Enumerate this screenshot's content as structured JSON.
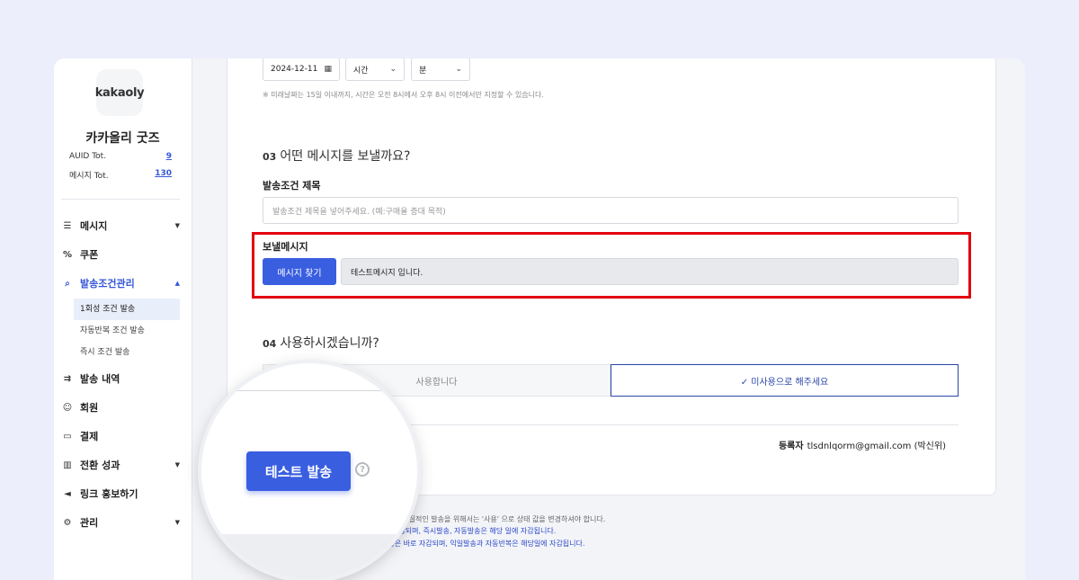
{
  "sidebar": {
    "logo_text": "kakaoly",
    "shop_name": "카카올리 굿즈",
    "stats": [
      {
        "label": "AUID Tot.",
        "value": "9"
      },
      {
        "label": "메시지 Tot.",
        "value": "130"
      }
    ],
    "nav": [
      {
        "label": "메시지",
        "icon": "message-icon",
        "glyph": "☰",
        "chevron": "▼"
      },
      {
        "label": "쿠폰",
        "icon": "percent-icon",
        "glyph": "%",
        "chevron": ""
      },
      {
        "label": "발송조건관리",
        "icon": "search-list-icon",
        "glyph": "⌕",
        "chevron": "▲"
      },
      {
        "label": "발송 내역",
        "icon": "send-history-icon",
        "glyph": "⇉",
        "chevron": ""
      },
      {
        "label": "회원",
        "icon": "members-icon",
        "glyph": "☺",
        "chevron": ""
      },
      {
        "label": "결제",
        "icon": "card-icon",
        "glyph": "▭",
        "chevron": ""
      },
      {
        "label": "전환 성과",
        "icon": "bar-chart-icon",
        "glyph": "▥",
        "chevron": "▼"
      },
      {
        "label": "링크 홍보하기",
        "icon": "megaphone-icon",
        "glyph": "◄",
        "chevron": ""
      },
      {
        "label": "관리",
        "icon": "gear-icon",
        "glyph": "⚙",
        "chevron": "▼"
      }
    ],
    "sub_items": [
      "1회성 조건 발송",
      "자동반복 조건 발송",
      "즉시 조건 발송"
    ]
  },
  "schedule": {
    "date": "2024-12-11",
    "hour_placeholder": "시간",
    "minute_placeholder": "분",
    "note": "※ 미래날짜는 15일 이내까지, 시간은 오전 8시에서 오후 8시 이전에서만 지정할 수 있습니다."
  },
  "section3": {
    "number": "03",
    "title": "어떤 메시지를 보낼까요?",
    "condition_label": "발송조건 제목",
    "condition_placeholder": "발송조건 제목을 넣어주세요. (예:구매율 증대 목적)",
    "message_label": "보낼메시지",
    "find_button": "메시지 찾기",
    "selected_message": "테스트메시지 입니다."
  },
  "section4": {
    "number": "04",
    "title": "사용하시겠습니까?",
    "use_label": "사용합니다",
    "nouse_label": "✓ 미사용으로 해주세요"
  },
  "registrant": {
    "label": "등록자",
    "value": "tlsdnlqorm@gmail.com (박신위)"
  },
  "test_send": {
    "label": "테스트 발송",
    "help": "?"
  },
  "footnotes": [
    "되며 실질적인 발송을 위해서는 '사용' 으로 상태 값을 변경하셔야 합니다.",
    "자감되며, 즉시발송, 자동발송은 해당 일에 자감됩니다.",
    "발송은 바로 자감되며, 익일발송과 자동반복은 해당일에 자감됩니다."
  ],
  "colors": {
    "accent": "#3a5ee0",
    "highlight": "#e3000f",
    "link": "#2a46c8"
  }
}
